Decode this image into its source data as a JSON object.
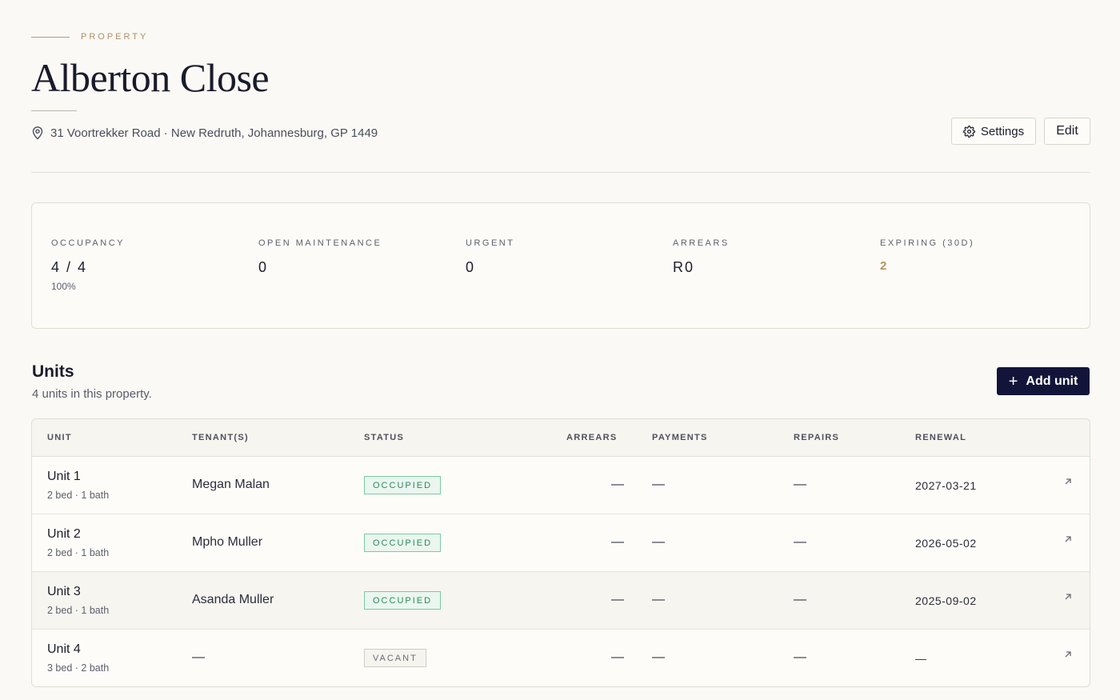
{
  "header": {
    "eyebrow": "PROPERTY",
    "title": "Alberton Close",
    "address": "31 Voortrekker Road · New Redruth, Johannesburg, GP 1449",
    "settings_label": "Settings",
    "edit_label": "Edit"
  },
  "stats": [
    {
      "label": "OCCUPANCY",
      "value": "4 / 4",
      "sub": "100%"
    },
    {
      "label": "OPEN MAINTENANCE",
      "value": "0"
    },
    {
      "label": "URGENT",
      "value": "0"
    },
    {
      "label": "ARREARS",
      "value": "R0"
    },
    {
      "label": "EXPIRING (30D)",
      "value": "2"
    }
  ],
  "units": {
    "title": "Units",
    "subtitle": "4 units in this property.",
    "add_label": "Add unit",
    "columns": [
      "UNIT",
      "TENANT(S)",
      "STATUS",
      "ARREARS",
      "PAYMENTS",
      "REPAIRS",
      "RENEWAL"
    ],
    "rows": [
      {
        "name": "Unit 1",
        "meta": "2 bed · 1 bath",
        "tenant": "Megan Malan",
        "status": "OCCUPIED",
        "arrears": "—",
        "payments": "—",
        "repairs": "—",
        "renewal": "2027-03-21"
      },
      {
        "name": "Unit 2",
        "meta": "2 bed · 1 bath",
        "tenant": "Mpho Muller",
        "status": "OCCUPIED",
        "arrears": "—",
        "payments": "—",
        "repairs": "—",
        "renewal": "2026-05-02"
      },
      {
        "name": "Unit 3",
        "meta": "2 bed · 1 bath",
        "tenant": "Asanda Muller",
        "status": "OCCUPIED",
        "arrears": "—",
        "payments": "—",
        "repairs": "—",
        "renewal": "2025-09-02"
      },
      {
        "name": "Unit 4",
        "meta": "3 bed · 2 bath",
        "tenant": "—",
        "status": "VACANT",
        "arrears": "—",
        "payments": "—",
        "repairs": "—",
        "renewal": "—"
      }
    ]
  },
  "colors": {
    "accent_gold": "#b8905c",
    "primary_navy": "#121539",
    "occupied_green": "#2c8a5a"
  },
  "icons": {
    "address": "map-pin-icon",
    "settings": "gear-icon",
    "add": "plus-icon",
    "row_open": "arrow-up-right-icon"
  }
}
